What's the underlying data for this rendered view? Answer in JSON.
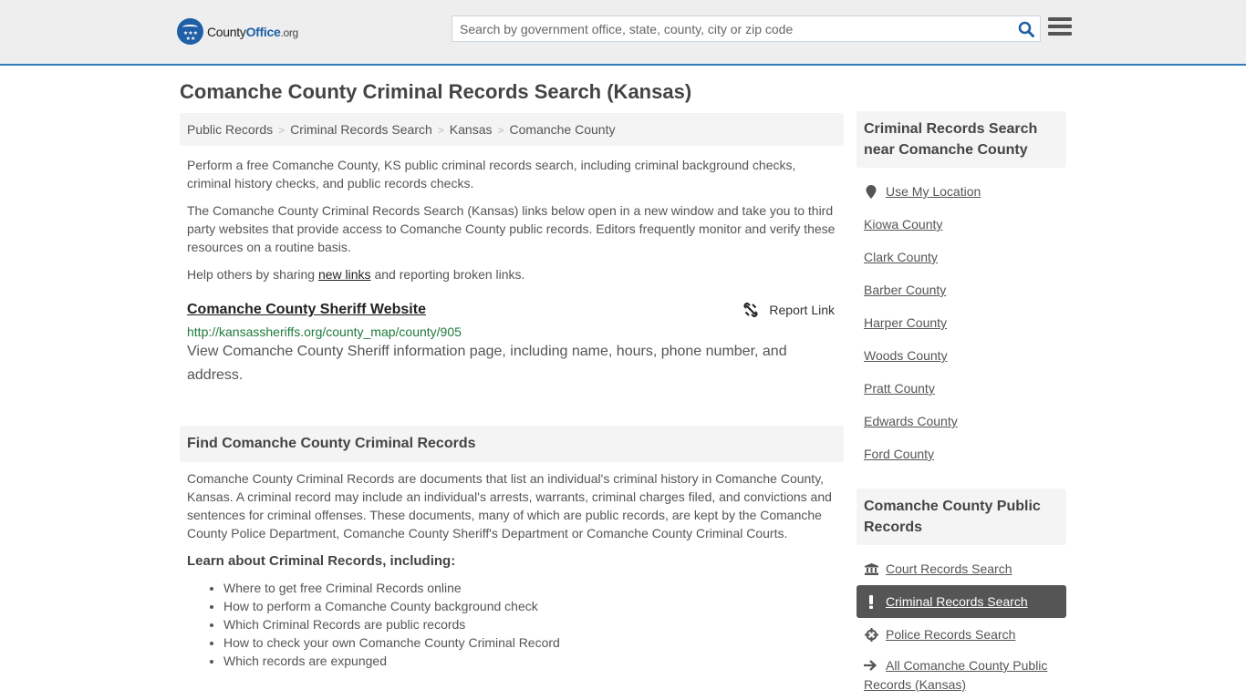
{
  "header": {
    "logo": {
      "name_part1": "County",
      "name_part2": "Office",
      "name_part3": ".org"
    },
    "search": {
      "placeholder": "Search by government office, state, county, city or zip code",
      "value": ""
    },
    "accent_color": "#337ab7"
  },
  "page_title": "Comanche County Criminal Records Search (Kansas)",
  "breadcrumb": [
    {
      "label": "Public Records"
    },
    {
      "label": "Criminal Records Search"
    },
    {
      "label": "Kansas"
    },
    {
      "label": "Comanche County"
    }
  ],
  "breadcrumb_separator": ">",
  "intro": {
    "p1": "Perform a free Comanche County, KS public criminal records search, including criminal background checks, criminal history checks, and public records checks.",
    "p2": "The Comanche County Criminal Records Search (Kansas) links below open in a new window and take you to third party websites that provide access to Comanche County public records. Editors frequently monitor and verify these resources on a routine basis.",
    "p3_before": "Help others by sharing ",
    "p3_link": "new links",
    "p3_after": " and reporting broken links."
  },
  "resource": {
    "title": "Comanche County Sheriff Website",
    "report_label": "Report Link",
    "url": "http://kansassheriffs.org/county_map/county/905",
    "description": "View Comanche County Sheriff information page, including name, hours, phone number, and address."
  },
  "find_section": {
    "heading": "Find Comanche County Criminal Records",
    "body": "Comanche County Criminal Records are documents that list an individual's criminal history in Comanche County, Kansas. A criminal record may include an individual's arrests, warrants, criminal charges filed, and convictions and sentences for criminal offenses. These documents, many of which are public records, are kept by the Comanche County Police Department, Comanche County Sheriff's Department or Comanche County Criminal Courts.",
    "learn_title": "Learn about Criminal Records, including:",
    "learn_items": [
      "Where to get free Criminal Records online",
      "How to perform a Comanche County background check",
      "Which Criminal Records are public records",
      "How to check your own Comanche County Criminal Record",
      "Which records are expunged"
    ]
  },
  "sidebar": {
    "nearby": {
      "heading": "Criminal Records Search near Comanche County",
      "use_location": "Use My Location",
      "counties": [
        "Kiowa County",
        "Clark County",
        "Barber County",
        "Harper County",
        "Woods County",
        "Pratt County",
        "Edwards County",
        "Ford County"
      ]
    },
    "public_records": {
      "heading": "Comanche County Public Records",
      "items": [
        {
          "label": "Court Records Search",
          "icon": "courthouse-icon",
          "active": false
        },
        {
          "label": "Criminal Records Search",
          "icon": "exclamation-icon",
          "active": true
        },
        {
          "label": "Police Records Search",
          "icon": "crosshair-icon",
          "active": false
        },
        {
          "label": "All Comanche County Public Records (Kansas)",
          "icon": "arrow-right-icon",
          "active": false
        }
      ]
    }
  }
}
